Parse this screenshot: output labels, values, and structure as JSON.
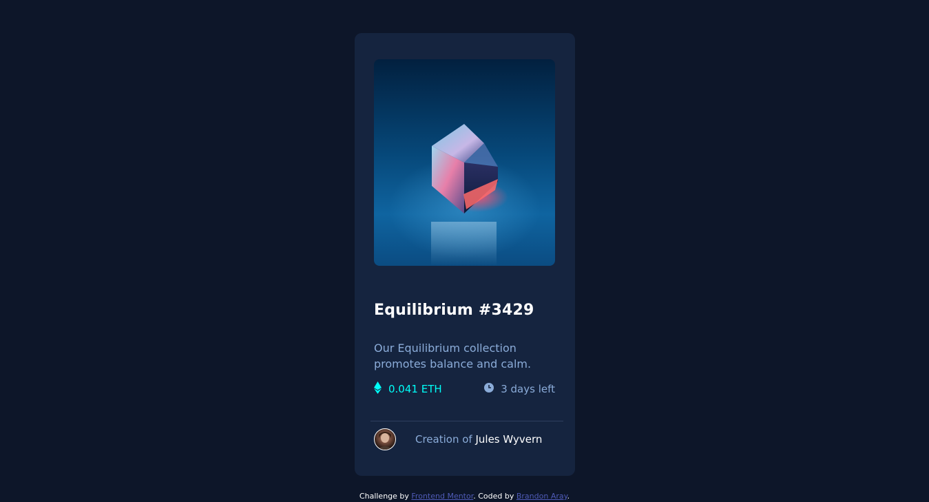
{
  "card": {
    "title": "Equilibrium #3429",
    "description": "Our Equilibrium collection promotes balance and calm.",
    "price": "0.041 ETH",
    "time_left": "3 days left",
    "creator_prefix": "Creation of",
    "creator_name": "Jules Wyvern"
  },
  "footer": {
    "prefix": "Challenge by",
    "link1": "Frontend Mentor",
    "middle": ". Coded by",
    "link2": "Brandon Aray",
    "suffix": "."
  },
  "colors": {
    "page_background": "#0D1629",
    "card_background": "#15243F",
    "accent_cyan": "#00FFF8",
    "soft_blue": "#8BACD9",
    "white": "#FFFFFF",
    "divider": "#2E405F"
  },
  "icons": {
    "ethereum": "ethereum-icon",
    "clock": "clock-icon"
  }
}
